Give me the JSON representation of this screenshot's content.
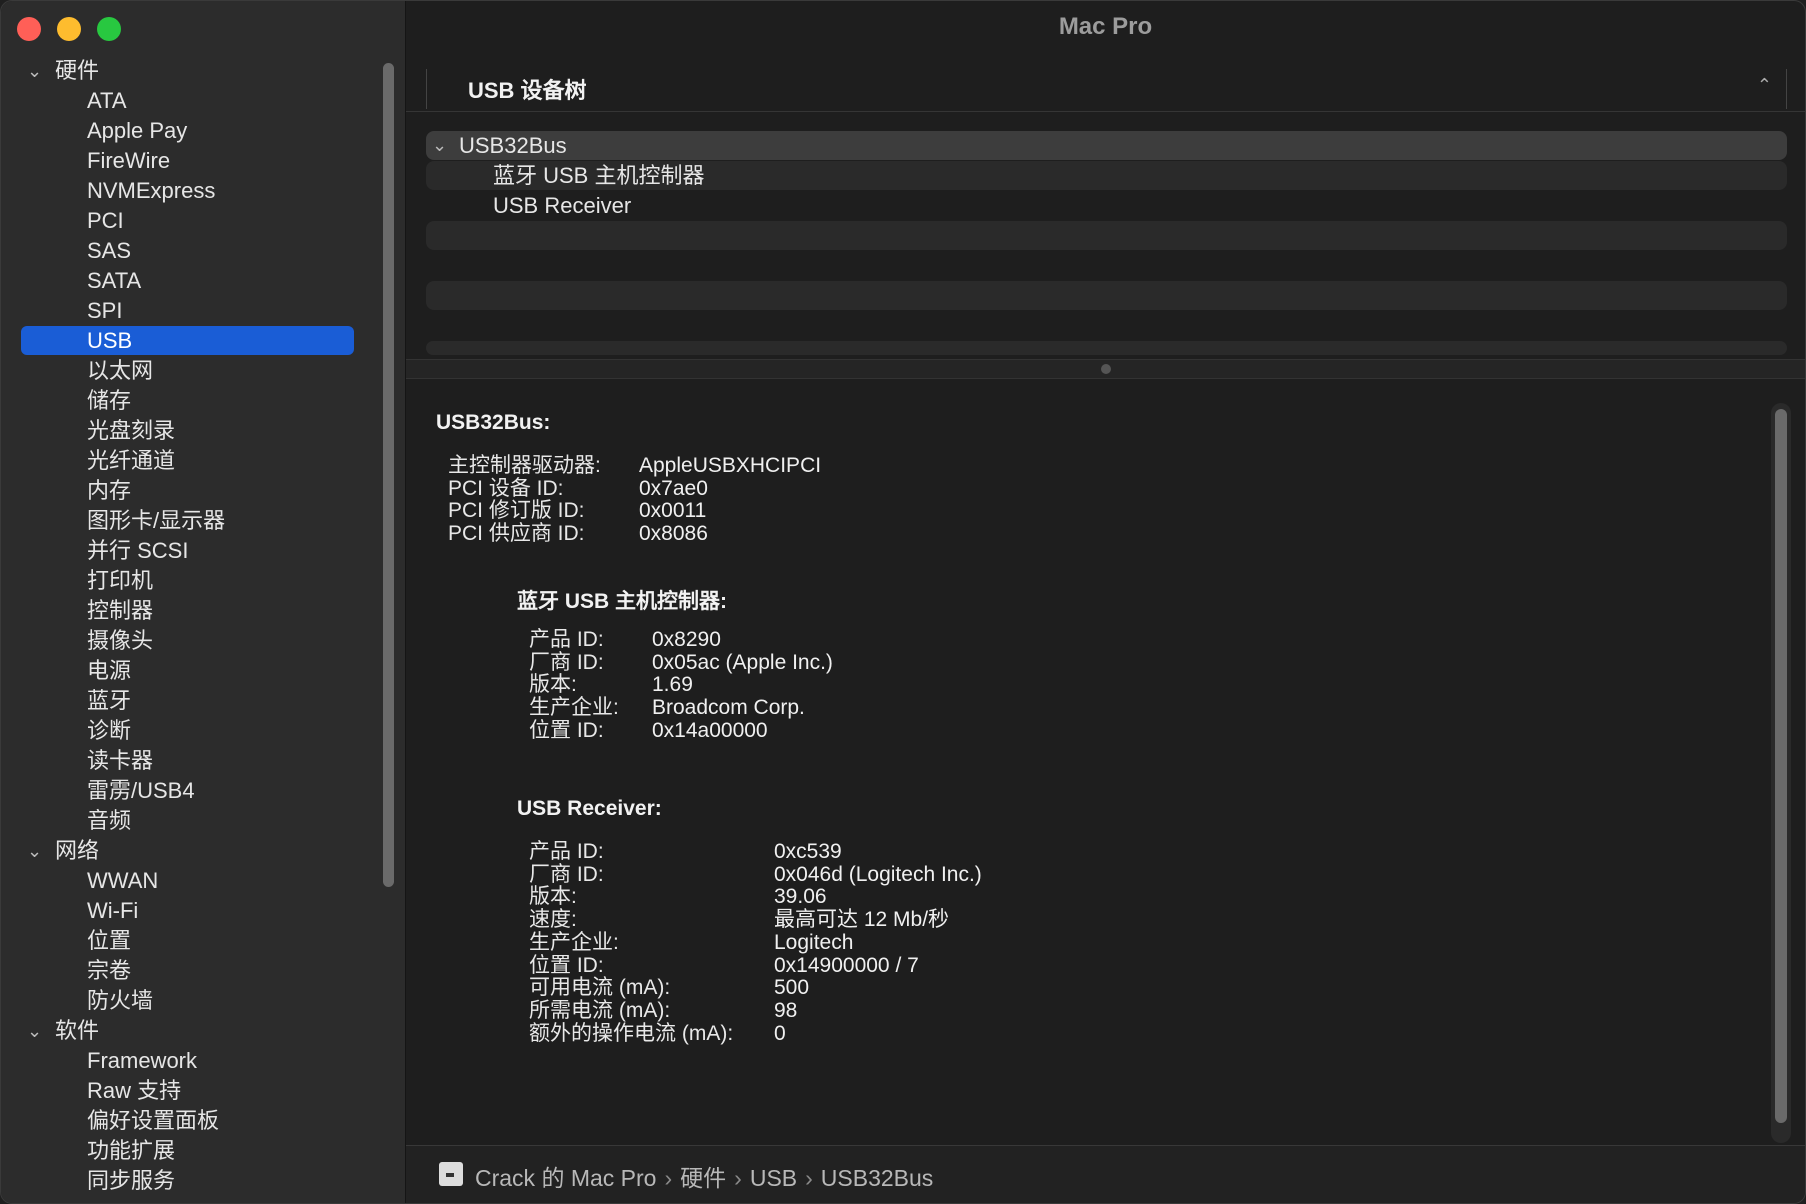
{
  "window": {
    "title": "Mac Pro"
  },
  "sidebar": {
    "groups": [
      {
        "label": "硬件",
        "items": [
          "ATA",
          "Apple Pay",
          "FireWire",
          "NVMExpress",
          "PCI",
          "SAS",
          "SATA",
          "SPI",
          "USB",
          "以太网",
          "储存",
          "光盘刻录",
          "光纤通道",
          "内存",
          "图形卡/显示器",
          "并行 SCSI",
          "打印机",
          "控制器",
          "摄像头",
          "电源",
          "蓝牙",
          "诊断",
          "读卡器",
          "雷雳/USB4",
          "音频"
        ]
      },
      {
        "label": "网络",
        "items": [
          "WWAN",
          "Wi-Fi",
          "位置",
          "宗卷",
          "防火墙"
        ]
      },
      {
        "label": "软件",
        "items": [
          "Framework",
          "Raw 支持",
          "偏好设置面板",
          "功能扩展",
          "同步服务"
        ]
      }
    ],
    "selected": "USB"
  },
  "header": {
    "label": "USB 设备树"
  },
  "tree": {
    "root": "USB32Bus",
    "children": [
      "蓝牙 USB 主机控制器",
      "USB Receiver"
    ]
  },
  "detail": {
    "bus": {
      "title": "USB32Bus:",
      "rows": [
        {
          "k": "主控制器驱动器:",
          "v": "AppleUSBXHCIPCI"
        },
        {
          "k": "PCI 设备 ID:",
          "v": "0x7ae0"
        },
        {
          "k": "PCI 修订版 ID:",
          "v": "0x0011"
        },
        {
          "k": "PCI 供应商 ID:",
          "v": "0x8086"
        }
      ]
    },
    "bt": {
      "title": "蓝牙 USB 主机控制器:",
      "rows": [
        {
          "k": "产品 ID:",
          "v": "0x8290"
        },
        {
          "k": "厂商 ID:",
          "v": "0x05ac (Apple Inc.)"
        },
        {
          "k": "版本:",
          "v": "1.69"
        },
        {
          "k": "生产企业:",
          "v": "Broadcom Corp."
        },
        {
          "k": "位置 ID:",
          "v": "0x14a00000"
        }
      ]
    },
    "receiver": {
      "title": "USB Receiver:",
      "rows": [
        {
          "k": "产品 ID:",
          "v": "0xc539"
        },
        {
          "k": "厂商 ID:",
          "v": "0x046d  (Logitech Inc.)"
        },
        {
          "k": "版本:",
          "v": "39.06"
        },
        {
          "k": "速度:",
          "v": "最高可达 12 Mb/秒"
        },
        {
          "k": "生产企业:",
          "v": "Logitech"
        },
        {
          "k": "位置 ID:",
          "v": "0x14900000 / 7"
        },
        {
          "k": "可用电流 (mA):",
          "v": "500"
        },
        {
          "k": "所需电流 (mA):",
          "v": "98"
        },
        {
          "k": "额外的操作电流 (mA):",
          "v": "0"
        }
      ]
    }
  },
  "pathbar": {
    "crumbs": [
      "Crack 的 Mac Pro",
      "硬件",
      "USB",
      "USB32Bus"
    ]
  }
}
